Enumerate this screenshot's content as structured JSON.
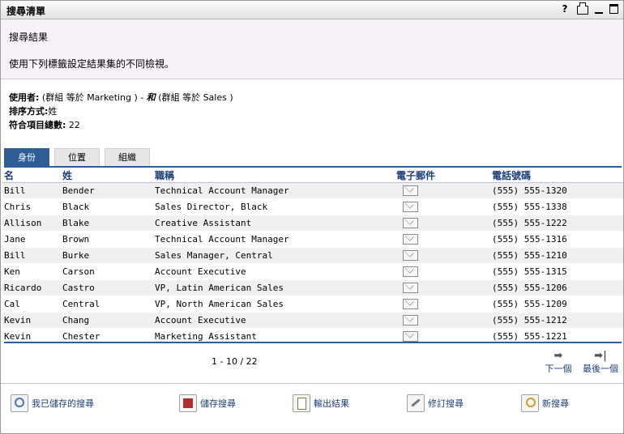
{
  "window": {
    "title": "搜尋清單"
  },
  "titlebar_icons": [
    "help-icon",
    "print-icon",
    "minimize-icon",
    "maximize-icon"
  ],
  "titlebar": {
    "help": "?"
  },
  "description": {
    "heading": "搜尋結果",
    "text": "使用下列標籤設定結果集的不同檢視。"
  },
  "criteria": {
    "user_label": "使用者:",
    "user_value": "(群組 等於 Marketing ) -",
    "and_op": "和",
    "user_value2": "(群組 等於 Sales )",
    "sort_label": "排序方式:",
    "sort_value": "姓",
    "total_label": "符合項目總數:",
    "total_value": "22"
  },
  "tabs": [
    {
      "label": "身份",
      "active": true
    },
    {
      "label": "位置",
      "active": false
    },
    {
      "label": "組織",
      "active": false
    }
  ],
  "columns": [
    "名",
    "姓",
    "職稱",
    "電子郵件",
    "電話號碼"
  ],
  "rows": [
    {
      "first": "Bill",
      "last": "Bender",
      "title": "Technical Account Manager",
      "phone": "(555) 555-1320"
    },
    {
      "first": "Chris",
      "last": "Black",
      "title": "Sales Director, Black",
      "phone": "(555) 555-1338"
    },
    {
      "first": "Allison",
      "last": "Blake",
      "title": "Creative Assistant",
      "phone": "(555) 555-1222"
    },
    {
      "first": "Jane",
      "last": "Brown",
      "title": "Technical Account Manager",
      "phone": "(555) 555-1316"
    },
    {
      "first": "Bill",
      "last": "Burke",
      "title": "Sales Manager, Central",
      "phone": "(555) 555-1210"
    },
    {
      "first": "Ken",
      "last": "Carson",
      "title": "Account Executive",
      "phone": "(555) 555-1315"
    },
    {
      "first": "Ricardo",
      "last": "Castro",
      "title": "VP, Latin American Sales",
      "phone": "(555) 555-1206"
    },
    {
      "first": "Cal",
      "last": "Central",
      "title": "VP, North American Sales",
      "phone": "(555) 555-1209"
    },
    {
      "first": "Kevin",
      "last": "Chang",
      "title": "Account Executive",
      "phone": "(555) 555-1212"
    },
    {
      "first": "Kevin",
      "last": "Chester",
      "title": "Marketing Assistant",
      "phone": "(555) 555-1221"
    }
  ],
  "pager": {
    "text": "1 - 10 / 22",
    "next": "下一個",
    "last": "最後一個"
  },
  "actions": [
    {
      "label": "我已儲存的搜尋",
      "icon": "saved-search-icon"
    },
    {
      "label": "儲存搜尋",
      "icon": "save-icon"
    },
    {
      "label": "輸出結果",
      "icon": "export-icon"
    },
    {
      "label": "修訂搜尋",
      "icon": "edit-search-icon"
    },
    {
      "label": "新搜尋",
      "icon": "new-search-icon"
    }
  ],
  "colors": {
    "accent": "#2f5d96",
    "header_text": "#1b3f79",
    "desc_bg": "#f6f2f6"
  }
}
